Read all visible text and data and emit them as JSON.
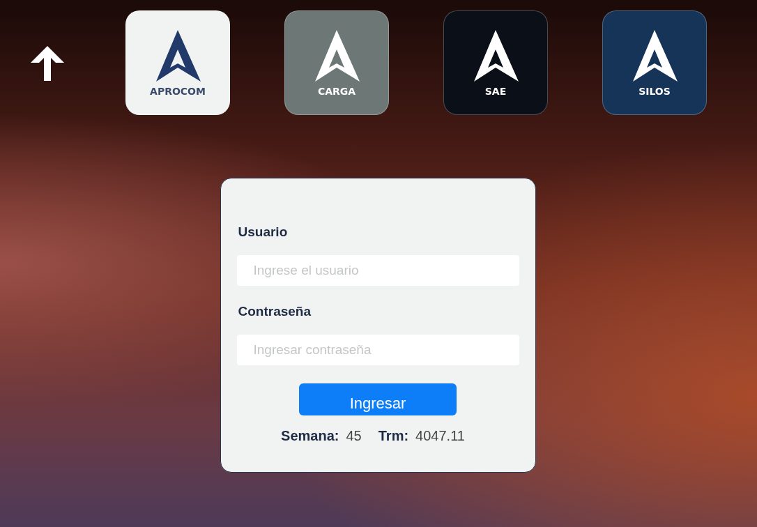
{
  "apps": [
    {
      "label": "APROCOM",
      "color": "#f1f3f3"
    },
    {
      "label": "CARGA",
      "color": "#6d7876"
    },
    {
      "label": "SAE",
      "color": "#0b0f17"
    },
    {
      "label": "SILOS",
      "color": "#163457"
    }
  ],
  "login": {
    "fields": [
      {
        "label": "Usuario",
        "placeholder": "Ingrese el usuario"
      },
      {
        "label": "Contraseña",
        "placeholder": "Ingresar contraseña"
      }
    ],
    "submit": "Ingresar",
    "stats": [
      {
        "label": "Semana:",
        "value": "45"
      },
      {
        "label": "Trm:",
        "value": "4047.11"
      }
    ]
  }
}
